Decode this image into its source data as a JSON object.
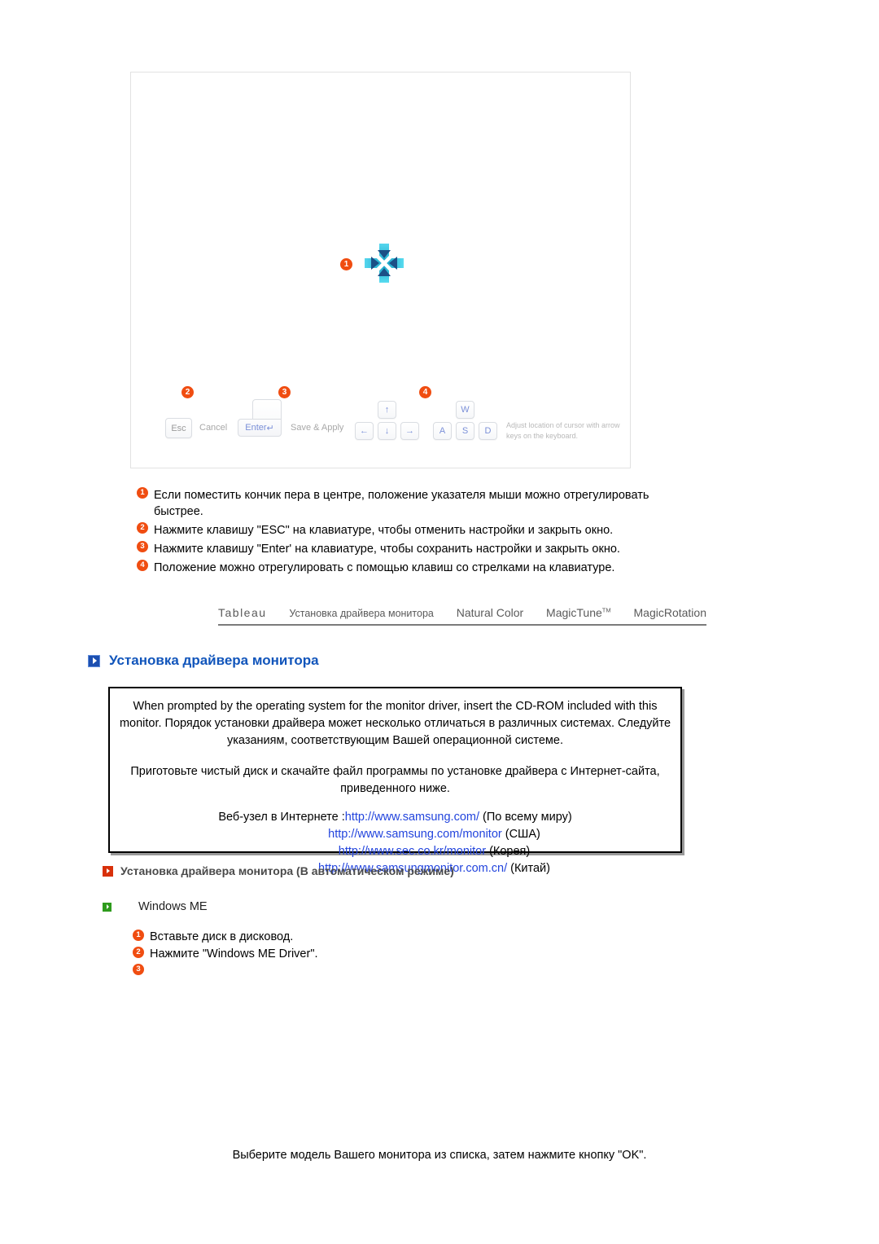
{
  "illustration": {
    "cursor_icon": "move-crosshair-icon",
    "cursor_badge": "1",
    "keys": {
      "esc": {
        "label": "Esc",
        "caption": "Cancel",
        "badge": "2"
      },
      "enter": {
        "label": "Enter",
        "symbol": "↵",
        "caption": "Save & Apply",
        "badge": "3"
      },
      "arrows": {
        "badge": "4",
        "up": "↑",
        "down": "↓",
        "left": "←",
        "right": "→"
      },
      "letters": [
        "W",
        "A",
        "S",
        "D"
      ],
      "caption": "Adjust location of cursor with arrow keys on the keyboard."
    }
  },
  "steps": [
    {
      "num": "1",
      "text": "Если поместить кончик пера в центре, положение указателя мыши можно отрегулировать быстрее."
    },
    {
      "num": "2",
      "text": "Нажмите клавишу \"ESC\" на клавиатуре, чтобы отменить настройки и закрыть окно."
    },
    {
      "num": "3",
      "text": "Нажмите клавишу \"Enter' на клавиатуре, чтобы сохранить настройки и закрыть окно."
    },
    {
      "num": "4",
      "text": "Положение можно отрегулировать с помощью клавиш со стрелками на клавиатуре."
    }
  ],
  "tabs": [
    {
      "label": "Tableau"
    },
    {
      "label": "Установка драйвера монитора"
    },
    {
      "label": "Natural Color"
    },
    {
      "label": "MagicTune",
      "sup": "TM"
    },
    {
      "label": "MagicRotation"
    }
  ],
  "section": {
    "icon": "blue-arrow-icon",
    "title": "Установка драйвера монитора"
  },
  "infobox": {
    "paragraph1": "When prompted by the operating system for the monitor driver, insert the CD-ROM included with this monitor. Порядок установки драйвера может несколько отличаться в различных системах. Следуйте указаниям, соответствующим Вашей операционной системе.",
    "paragraph2": "Приготовьте чистый диск и скачайте файл программы по установке драйвера с Интернет-сайта, приведенного ниже.",
    "url_label": "Веб-узел в Интернете :",
    "urls": [
      {
        "url": "http://www.samsung.com/",
        "region": "(По всему миру)"
      },
      {
        "url": "http://www.samsung.com/monitor",
        "region": "(США)"
      },
      {
        "url": "http://www.sec.co.kr/monitor",
        "region": "(Корея)"
      },
      {
        "url": "http://www.samsungmonitor.com.cn/",
        "region": "(Китай)"
      }
    ]
  },
  "subsection": {
    "icon": "red-arrow-icon",
    "title": "Установка драйвера монитора (В автоматическом режиме)",
    "os_icon": "green-arrow-icon",
    "os_label": "Windows ME",
    "steps": [
      {
        "num": "1",
        "text": "Вставьте диск в дисковод."
      },
      {
        "num": "2",
        "text": "Нажмите \"Windows ME Driver\"."
      },
      {
        "num": "3",
        "text": ""
      }
    ]
  },
  "bottom_note": "Выберите модель Вашего монитора из списка, затем нажмите кнопку \"OK\".",
  "colors": {
    "accent_blue": "#1155bb",
    "link_blue": "#2244dd",
    "badge_orange": "#f04d11",
    "red_icon": "#d8300a",
    "green_icon": "#2e9b1c",
    "key_blue": "#7b90d8"
  }
}
